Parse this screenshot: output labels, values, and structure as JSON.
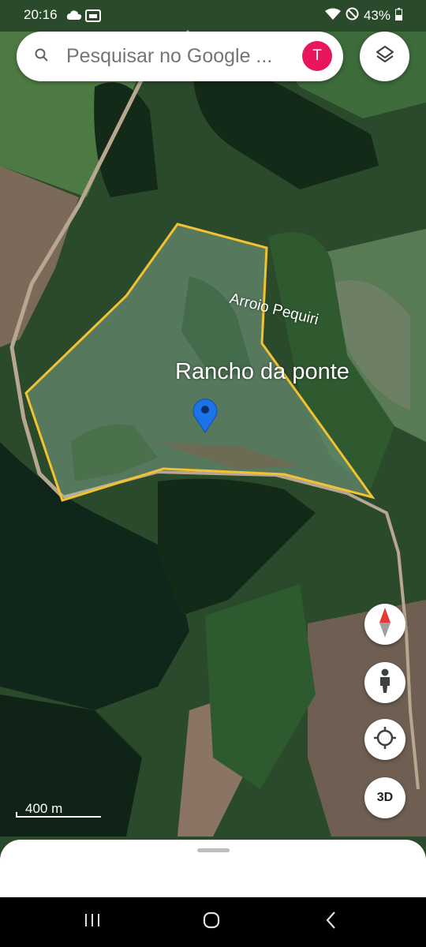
{
  "status_bar": {
    "time": "20:16",
    "battery": "43%",
    "icons": [
      "cloud-icon",
      "notification-icon",
      "wifi-icon",
      "do-not-disturb-icon",
      "battery-icon"
    ]
  },
  "search": {
    "placeholder": "Pesquisar no Google ...",
    "avatar_letter": "T",
    "avatar_color": "#e8175d"
  },
  "map": {
    "type": "satellite",
    "labels": {
      "river": "Arroio Pequiri",
      "place": "Rancho da ponte"
    },
    "polygon_color": "#f2c230",
    "marker_color": "#1a73e8",
    "scale": "400 m"
  },
  "controls": {
    "three_d": "3D",
    "icons": [
      "compass-icon",
      "pegman-icon",
      "my-location-icon",
      "layers-icon"
    ]
  },
  "navigation": {
    "buttons": [
      "recent-apps-icon",
      "home-icon",
      "back-icon"
    ]
  }
}
